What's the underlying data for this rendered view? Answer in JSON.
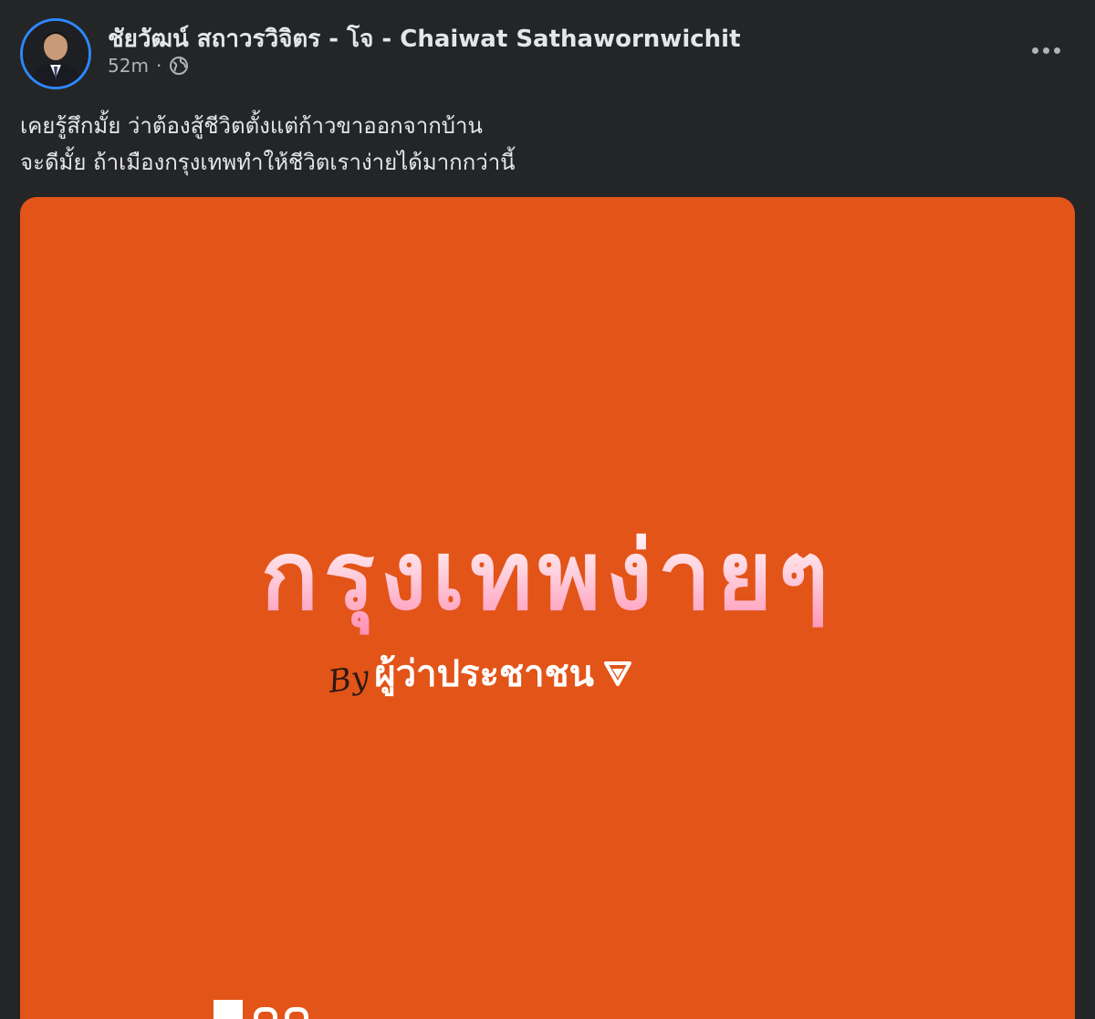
{
  "post": {
    "author": "ชัยวัฒน์ สถาวรวิจิตร - โจ - Chaiwat Sathawornwichit",
    "timestamp": "52m",
    "separator": "·",
    "privacy_icon": "globe-icon",
    "more_icon": "more-options-icon",
    "caption_lines": [
      "เคยรู้สึกมั้ย ว่าต้องสู้ชีวิตตั้งแต่ก้าวขาออกจากบ้าน",
      "จะดีมั้ย ถ้าเมืองกรุงเทพทำให้ชีวิตเราง่ายได้มากกว่านี้"
    ]
  },
  "image": {
    "headline": "กรุงเทพง่ายๆ",
    "by_signature": "By",
    "byline": "ผู้ว่าประชาชน",
    "background_color": "#e35418",
    "logo_icon": "triangle-logo-icon"
  }
}
